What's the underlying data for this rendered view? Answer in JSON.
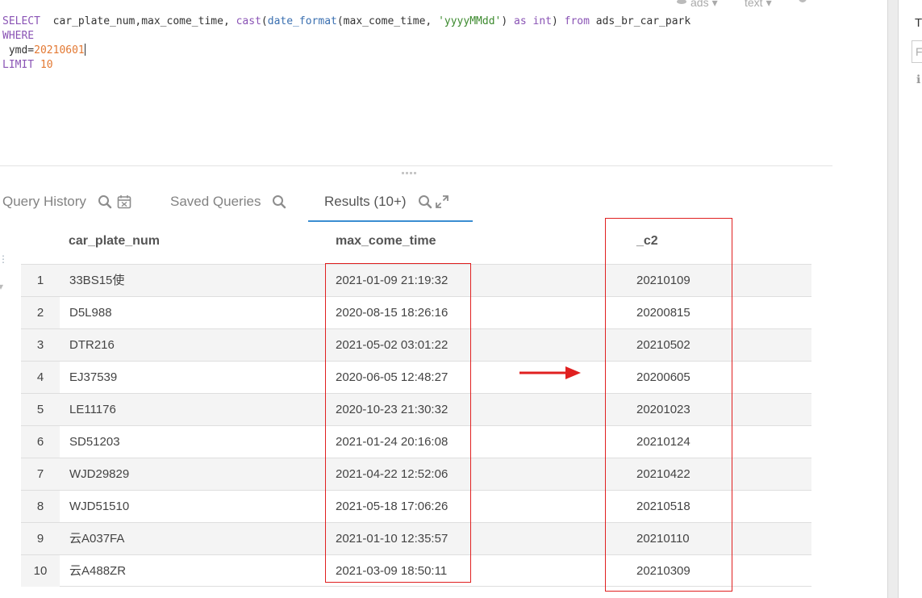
{
  "editor": {
    "line1": {
      "select": "SELECT",
      "cols": "  car_plate_num,max_come_time, ",
      "cast_fn": "cast",
      "open": "(",
      "date_fn": "date_format",
      "args": "(max_come_time, ",
      "fmt": "'yyyyMMdd'",
      "close": ") ",
      "as_kw": "as",
      "sp": " ",
      "int_kw": "int",
      "close2": ") ",
      "from_kw": "from",
      "table": " ads_br_car_park"
    },
    "line2": {
      "where": "WHERE"
    },
    "line3": {
      "field": " ymd=",
      "value": "20210601"
    },
    "line4": {
      "limit": "LIMIT",
      "sp": " ",
      "value": "10"
    },
    "top_menu": {
      "db": "ads",
      "type": "text"
    }
  },
  "tabs": {
    "query_history": "Query History",
    "saved_queries": "Saved Queries",
    "results": "Results (10+)"
  },
  "results": {
    "columns": [
      "car_plate_num",
      "max_come_time",
      "_c2"
    ],
    "rows": [
      {
        "idx": "1",
        "car_plate_num": "33BS15使",
        "max_come_time": "2021-01-09 21:19:32",
        "c2": "20210109"
      },
      {
        "idx": "2",
        "car_plate_num": "D5L988",
        "max_come_time": "2020-08-15 18:26:16",
        "c2": "20200815"
      },
      {
        "idx": "3",
        "car_plate_num": "DTR216",
        "max_come_time": "2021-05-02 03:01:22",
        "c2": "20210502"
      },
      {
        "idx": "4",
        "car_plate_num": "EJ37539",
        "max_come_time": "2020-06-05 12:48:27",
        "c2": "20200605"
      },
      {
        "idx": "5",
        "car_plate_num": "LE11176",
        "max_come_time": "2020-10-23 21:30:32",
        "c2": "20201023"
      },
      {
        "idx": "6",
        "car_plate_num": "SD51203",
        "max_come_time": "2021-01-24 20:16:08",
        "c2": "20210124"
      },
      {
        "idx": "7",
        "car_plate_num": "WJD29829",
        "max_come_time": "2021-04-22 12:52:06",
        "c2": "20210422"
      },
      {
        "idx": "8",
        "car_plate_num": "WJD51510",
        "max_come_time": "2021-05-18 17:06:26",
        "c2": "20210518"
      },
      {
        "idx": "9",
        "car_plate_num": "云A037FA",
        "max_come_time": "2021-01-10 12:35:57",
        "c2": "20210110"
      },
      {
        "idx": "10",
        "car_plate_num": "云A488ZR",
        "max_come_time": "2021-03-09 18:50:11",
        "c2": "20210309"
      }
    ]
  },
  "right_panel": {
    "frag1": "T",
    "frag2": "F"
  },
  "colors": {
    "accent": "#3b8dd1",
    "annotation": "#e02020",
    "keyword": "#8a54b5",
    "string": "#3c8a2e",
    "number": "#e37933"
  },
  "icons": [
    "search-icon",
    "calendar-icon",
    "expand-icon",
    "gear-icon",
    "grip-icon",
    "arrow-right-icon"
  ]
}
